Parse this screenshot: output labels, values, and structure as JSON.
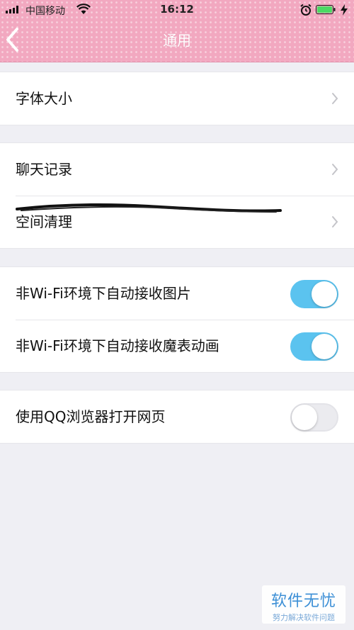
{
  "status_bar": {
    "carrier": "中国移动",
    "time": "16:12"
  },
  "nav": {
    "title": "通用"
  },
  "groups": [
    {
      "rows": [
        {
          "label": "字体大小",
          "type": "chevron"
        }
      ]
    },
    {
      "rows": [
        {
          "label": "聊天记录",
          "type": "chevron"
        },
        {
          "label": "空间清理",
          "type": "chevron"
        }
      ]
    },
    {
      "rows": [
        {
          "label": "非Wi-Fi环境下自动接收图片",
          "type": "toggle",
          "on": true
        },
        {
          "label": "非Wi-Fi环境下自动接收魔表动画",
          "type": "toggle",
          "on": true
        }
      ]
    },
    {
      "rows": [
        {
          "label": "使用QQ浏览器打开网页",
          "type": "toggle",
          "on": false
        }
      ]
    }
  ],
  "watermark": {
    "main": "软件无忧",
    "sub": "努力解决软件问题"
  },
  "colors": {
    "header_pink": "#f2a8c0",
    "toggle_on": "#5bc3ef",
    "toggle_off": "#ebebef",
    "background": "#efeff4"
  },
  "icons": [
    "signal-icon",
    "wifi-icon",
    "alarm-icon",
    "battery-icon",
    "charging-icon",
    "back-chevron-icon",
    "chevron-right-icon"
  ]
}
